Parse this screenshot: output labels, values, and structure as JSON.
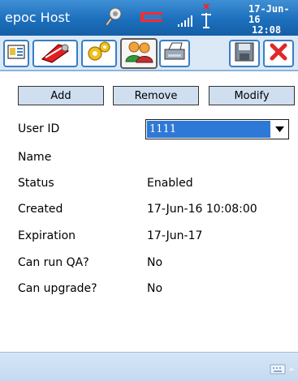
{
  "titlebar": {
    "app_title": "epoc Host",
    "clock_date": "17-Jun-16",
    "clock_time": "12:08",
    "icons": [
      "sync-icon",
      "battery-icon",
      "signal-icon",
      "no-connection-icon"
    ]
  },
  "toolbar": {
    "buttons": [
      {
        "name": "home-icon"
      },
      {
        "name": "tools-icon"
      },
      {
        "name": "settings-icon"
      },
      {
        "name": "users-icon",
        "active": true
      },
      {
        "name": "printer-icon"
      },
      {
        "name": "save-icon"
      },
      {
        "name": "close-icon"
      }
    ]
  },
  "actions": {
    "add_label": "Add",
    "remove_label": "Remove",
    "modify_label": "Modify"
  },
  "form": {
    "user_id_label": "User ID",
    "user_id_value": "1111",
    "name_label": "Name",
    "name_value": "",
    "status_label": "Status",
    "status_value": "Enabled",
    "created_label": "Created",
    "created_value": "17-Jun-16 10:08:00",
    "expiration_label": "Expiration",
    "expiration_value": "17-Jun-17",
    "can_run_qa_label": "Can run QA?",
    "can_run_qa_value": "No",
    "can_upgrade_label": "Can upgrade?",
    "can_upgrade_value": "No"
  },
  "bottombar": {
    "keyboard_icon": "keyboard-icon"
  },
  "colors": {
    "titlebar": "#1c6fbd",
    "selection": "#2f79d6",
    "button_face": "#cfdff0"
  }
}
